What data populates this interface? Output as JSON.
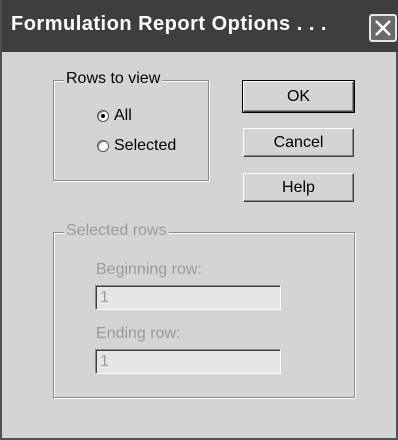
{
  "window": {
    "title": "Formulation Report Options . . ."
  },
  "rows_to_view": {
    "legend": "Rows to view",
    "options": [
      {
        "label": "All",
        "selected": true
      },
      {
        "label": "Selected",
        "selected": false
      }
    ]
  },
  "buttons": {
    "ok": "OK",
    "cancel": "Cancel",
    "help": "Help"
  },
  "selected_rows": {
    "legend": "Selected rows",
    "enabled": false,
    "beginning_label": "Beginning row:",
    "beginning_value": "1",
    "ending_label": "Ending row:",
    "ending_value": "1"
  },
  "icons": {
    "close": "close-icon",
    "radio_selected": "radio-selected-icon",
    "radio_unselected": "radio-unselected-icon"
  },
  "colors": {
    "titlebar": "#3e3e3e",
    "dialog_face": "#d4d4d4",
    "disabled_text": "#9a9a9a"
  }
}
